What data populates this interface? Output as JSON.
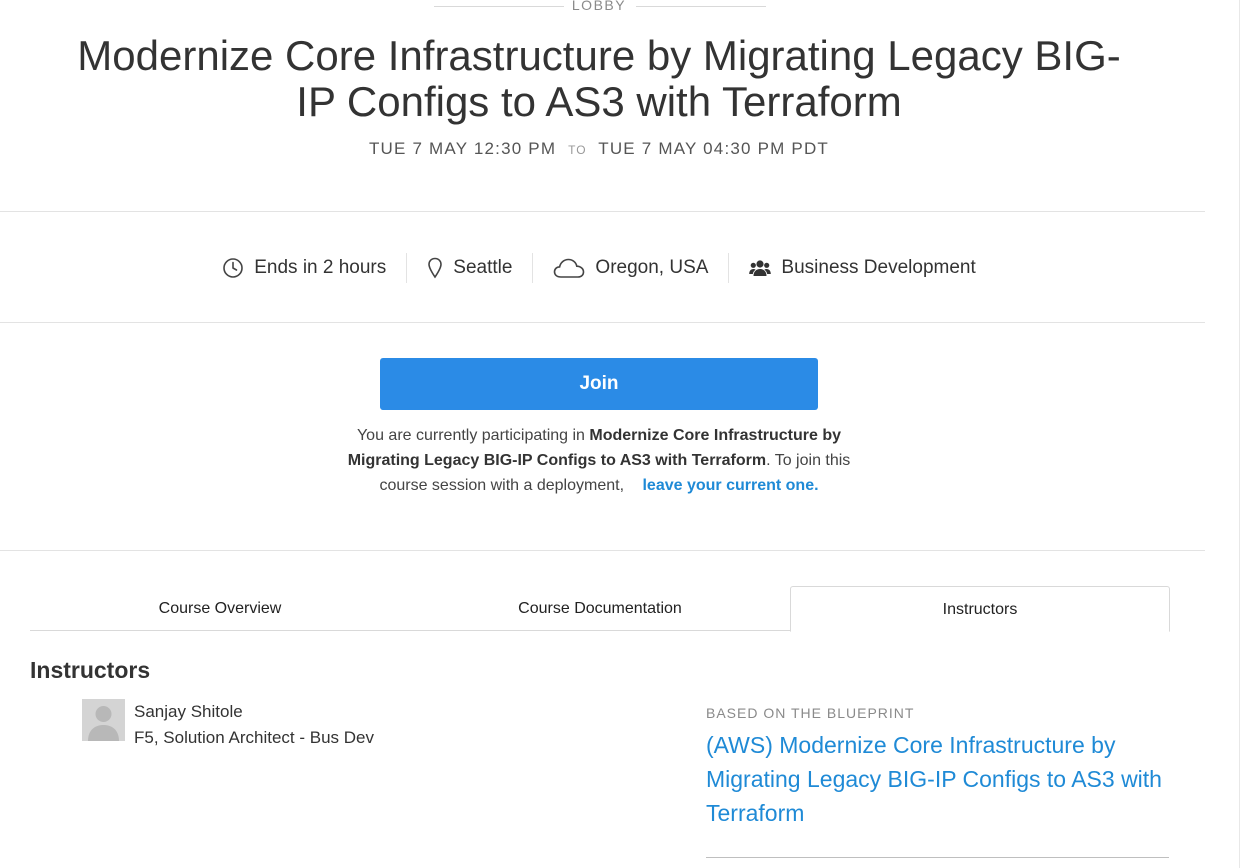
{
  "lobby_label": "LOBBY",
  "title": "Modernize Core Infrastructure by Migrating Legacy BIG-IP Configs to AS3 with Terraform",
  "timeline": {
    "start": "TUE 7 MAY 12:30 PM",
    "to": "TO",
    "end": "TUE 7 MAY 04:30 PM PDT"
  },
  "meta": {
    "ends": "Ends in 2 hours",
    "location": "Seattle",
    "region": "Oregon, USA",
    "department": "Business Development",
    "icons": [
      "clock-icon",
      "map-pin-icon",
      "cloud-icon",
      "users-icon"
    ]
  },
  "join": {
    "label": "Join",
    "color": "#2b8be6"
  },
  "notice": {
    "prefix": "You are currently participating in",
    "course": "Modernize Core Infrastructure by Migrating Legacy BIG-IP Configs to AS3 with Terraform",
    "middle": ". To join this course session with a deployment,",
    "link": "leave your current one."
  },
  "tabs": [
    {
      "label": "Course Overview",
      "active": false
    },
    {
      "label": "Course Documentation",
      "active": false
    },
    {
      "label": "Instructors",
      "active": true
    }
  ],
  "instructors": {
    "heading": "Instructors",
    "items": [
      {
        "name": "Sanjay Shitole",
        "role": "F5, Solution Architect - Bus Dev"
      }
    ]
  },
  "blueprint": {
    "label": "BASED ON THE BLUEPRINT",
    "link": "(AWS) Modernize Core Infrastructure by Migrating Legacy BIG-IP Configs to AS3 with Terraform"
  },
  "colors": {
    "link": "#1f8ad6",
    "text": "#333333",
    "muted": "#8a8a8a"
  }
}
